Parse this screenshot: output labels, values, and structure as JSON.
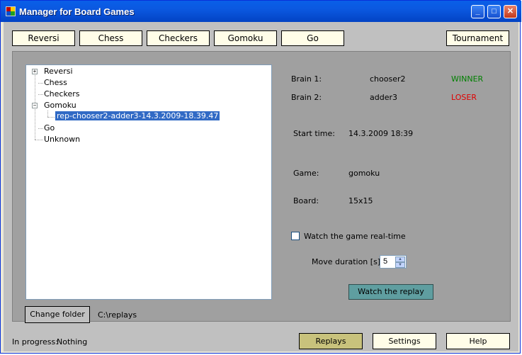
{
  "window": {
    "title": "Manager for Board Games",
    "controls": {
      "minimize": "_",
      "maximize": "□",
      "close": "✕"
    }
  },
  "game_buttons": [
    "Reversi",
    "Chess",
    "Checkers",
    "Gomoku",
    "Go"
  ],
  "tournament_label": "Tournament",
  "tree": {
    "items": [
      {
        "label": "Reversi",
        "expander": "+"
      },
      {
        "label": "Chess"
      },
      {
        "label": "Checkers"
      },
      {
        "label": "Gomoku",
        "expander": "−"
      },
      {
        "label": "rep-chooser2-adder3-14.3.2009-18.39.47",
        "selected": true
      },
      {
        "label": "Go"
      },
      {
        "label": "Unknown"
      }
    ]
  },
  "details": {
    "brain1_label": "Brain 1:",
    "brain1_value": "chooser2",
    "brain1_result": "WINNER",
    "brain2_label": "Brain 2:",
    "brain2_value": "adder3",
    "brain2_result": "LOSER",
    "start_label": "Start time:",
    "start_value": "14.3.2009 18:39",
    "game_label": "Game:",
    "game_value": "gomoku",
    "board_label": "Board:",
    "board_value": "15x15",
    "realtime_label": "Watch the game real-time",
    "realtime_checked": false,
    "move_duration_label": "Move duration [s]:",
    "move_duration_value": "5",
    "watch_button": "Watch the replay"
  },
  "folder": {
    "button": "Change folder",
    "path": "C:\\replays"
  },
  "status": {
    "label": "In progress:",
    "value": "Nothing"
  },
  "bottom_buttons": {
    "replays": "Replays",
    "settings": "Settings",
    "help": "Help"
  },
  "colors": {
    "titlebar": "#0a5fe8",
    "client": "#c0c0c0",
    "panel": "#a0a0a0",
    "selected": "#316ac5",
    "winner": "#008000",
    "loser": "#e00000",
    "active_tab": "#c8c27c",
    "watch_button": "#5f9ea0"
  }
}
